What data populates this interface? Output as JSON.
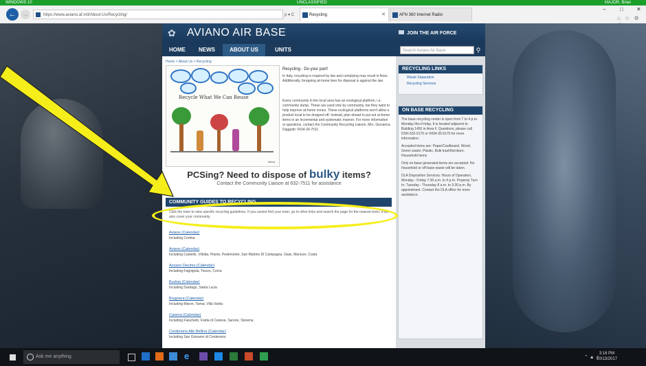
{
  "classification": {
    "left": "WINDOWS 10",
    "center": "UNCLASSIFIED",
    "right": "MAJOR, Brian"
  },
  "browser": {
    "url": "https://www.aviano.af.mil/About-Us/Recycling/",
    "addr_controls": "ρ ▾ C",
    "tabs": [
      {
        "label": "Recycling",
        "active": true
      },
      {
        "label": "AFN 360 Internet Radio",
        "active": false
      }
    ],
    "window_controls": {
      "minimize": "–",
      "maximize": "□",
      "close": "✕"
    },
    "toolbar_icons": "⌂ ☆ ⚙ ☺"
  },
  "site": {
    "title": "AVIANO AIR BASE",
    "join": "JOIN THE AIR FORCE",
    "nav": [
      "HOME",
      "NEWS",
      "ABOUT US",
      "UNITS"
    ],
    "active_nav": "ABOUT US",
    "search_placeholder": "Search Aviano Air Base",
    "search_icon": "magnifier-icon"
  },
  "main": {
    "breadcrumb": "Home > About Us > Recycling",
    "drawing_caption": "Recycle What We Can Reuse",
    "drawing_signature": "Alexa",
    "intro_title": "Recycling - Do your part!",
    "paragraphs": [
      "In Italy, recycling is required by law and complying may result in fines. Additionally, foregoing at-home fees for disposal is against the law.",
      "Every community in the local area has an ecological platform, i.e. community dump. These are used only by community, but they want to help improve at-home zones. These ecological platforms won't allow a product local to be dropped off. Instead, plan ahead to put out at-home items in an incremental and systematic manner. For more information or questions, contact the Community Recycling Liaison, Mrs. Giovanna Daggetti: 0434-30-7511"
    ],
    "pcs_before": "PCSing? Need to dispose of ",
    "pcs_bulky": "bulky",
    "pcs_after": " items?",
    "contact": "Contact the Community Liaison at 632-7511 for assistance",
    "guides_header": "COMMUNITY GUIDES TO RECYCLING",
    "guides_intro": "Click the town to view specific recycling guidelines. If you cannot find your town, go to other links and search the page for the nearest town; it will also cover your community.",
    "towns": [
      {
        "name": "Aviano (Calendar)",
        "includes": "Including Cortina"
      },
      {
        "name": "Aviano (Calendar)",
        "includes": "Including Castello, Villotta, Piante, Pedemonte, San Martino Di Campagna, Giais, Marsure, Costa"
      },
      {
        "name": "Azzano Decimo (Calendar)",
        "includes": "Including Fagnigola, Tiezzo, Corva"
      },
      {
        "name": "Budoia (Calendar)",
        "includes": "Including Dardago, Santa Lucia"
      },
      {
        "name": "Brugnera (Calendar)",
        "includes": "Including Maron, Tamai, Villa Varda"
      },
      {
        "name": "Caneva (Calendar)",
        "includes": "Including Fiaschetti, Fratta di Caneva, Sarone, Stevena"
      },
      {
        "name": "Cordenons Alle Bellina (Calendar)",
        "includes": "Including San Giovanni di Cordenons"
      }
    ]
  },
  "sidebar": {
    "links_header": "RECYCLING LINKS",
    "links": [
      "Waste Separation",
      "Recycling Services"
    ],
    "onbase_header": "ON BASE RECYCLING",
    "onbase_text": [
      "The base recycling center is open from 7 to 4 p.m. Monday thru Friday. It is located adjacent to Building 1450 in Area F. Questions, please call DSN 632-5170 or 0434-30-5170 for more information.",
      "Accepted items are: Paper/Cardboard, Wood, Green waste, Plastic, Bulk trash/furniture, Household items",
      "Only on-base generated items are accepted. No household or off-base waste will be taken.",
      "DLA Disposition Services: Hours of Operation, Monday - Friday 7:30 a.m. to 4 p.m. Property Turn In: Tuesday - Thursday 8 a.m. to 3:30 p.m. By appointment. Contact the DLA office for more assistance."
    ]
  },
  "taskbar": {
    "search_placeholder": "Ask me anything",
    "time": "3:16 PM",
    "date": "10/13/2017"
  },
  "annotation": {
    "arrow_color": "#f5ee1a",
    "ellipse_color": "#f5ee1a"
  }
}
